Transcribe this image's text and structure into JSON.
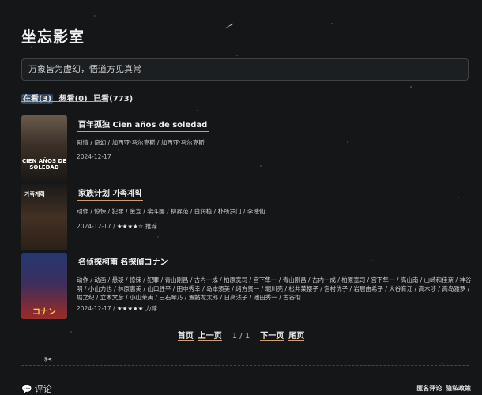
{
  "site": {
    "title": "坐忘影室"
  },
  "search": {
    "placeholder": "万象皆为虚幻，悟道方见真常"
  },
  "tabs": [
    {
      "label": "在看(3)",
      "active": true
    },
    {
      "label": "想看(0)",
      "active": false
    },
    {
      "label": "已看(773)",
      "active": false
    }
  ],
  "items": [
    {
      "title": "百年孤独 Cien años de soledad",
      "meta": "剧情 / 奇幻 / 加西亚·马尔克斯 / 加西亚·马尔克斯",
      "date": "2024-12-17",
      "rating": "",
      "recommend": "",
      "poster_text": "CIEN AÑOS DE SOLEDAD"
    },
    {
      "title": "家族计划 가족계획",
      "meta": "动作 / 惊悚 / 犯罪 / 金宣 / 裴斗娜 / 柳昇范 / 白润植 / 朴所罗门 / 李璁仙",
      "date": "2024-12-17 / ",
      "rating": "★★★★☆",
      "recommend": "推荐",
      "poster_text": "가족계획"
    },
    {
      "title": "名侦探柯南 名探偵コナン",
      "meta": "动作 / 动画 / 悬疑 / 惊悚 / 犯罪 / 青山刚昌 / 古内一成 / 柏原宽司 / 宫下隼一 / 青山刚昌 / 古内一成 / 柏原宽司 / 宫下隼一 / 高山南 / 山崎和佳奈 / 神谷明 / 小山力也 / 林原惠美 / 山口胜平 / 田中秀幸 / 岛本须美 / 绪方贤一 / 堀川亮 / 松井菜樱子 / 宫村优子 / 岩居由希子 / 大谷育江 / 高木涉 / 高岛雅罗 / 堀之纪 / 立木文彦 / 小山茉美 / 三石琴乃 / 置鲇龙太郎 / 日高法子 / 池田秀一 / 古谷彻",
      "date": "2024-12-17 / ",
      "rating": "★★★★★",
      "recommend": "力荐",
      "poster_text": "コナン"
    }
  ],
  "pager": {
    "first": "首页",
    "prev": "上一页",
    "count": "1 / 1",
    "next": "下一页",
    "last": "尾页"
  },
  "footer": {
    "comment_label": "评论",
    "anon_comment": "匿名评论",
    "privacy": "隐私政策"
  }
}
